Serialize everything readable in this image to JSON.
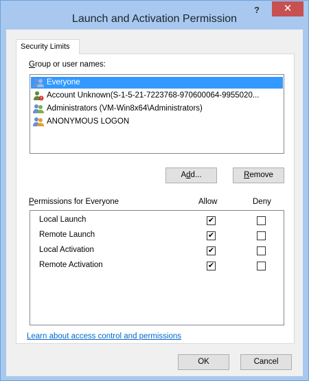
{
  "dialog": {
    "title": "Launch and Activation Permission",
    "help_label": "?",
    "close_label": "✕"
  },
  "tab": {
    "label": "Security Limits"
  },
  "group": {
    "label_prefix": "G",
    "label_rest": "roup or user names:",
    "items": [
      {
        "name": "Everyone",
        "selected": true
      },
      {
        "name": "Account Unknown(S-1-5-21-7223768-970600064-9955020...",
        "selected": false
      },
      {
        "name": "Administrators (VM-Win8x64\\Administrators)",
        "selected": false
      },
      {
        "name": "ANONYMOUS LOGON",
        "selected": false
      }
    ]
  },
  "buttons": {
    "add_pre": "A",
    "add_ul": "d",
    "add_post": "d...",
    "remove_ul": "R",
    "remove_post": "emove",
    "ok": "OK",
    "cancel": "Cancel"
  },
  "permissions": {
    "header_prefix": "P",
    "header_rest": "ermissions for Everyone",
    "allow_label": "Allow",
    "deny_label": "Deny",
    "rows": [
      {
        "name": "Local Launch",
        "allow": true,
        "deny": false
      },
      {
        "name": "Remote Launch",
        "allow": true,
        "deny": false
      },
      {
        "name": "Local Activation",
        "allow": true,
        "deny": false
      },
      {
        "name": "Remote Activation",
        "allow": true,
        "deny": false
      }
    ]
  },
  "link": {
    "label": "Learn about access control and permissions"
  },
  "colors": {
    "selection": "#3399ff",
    "close": "#c75050",
    "frame": "#a8c8ef",
    "link": "#0066cc"
  }
}
